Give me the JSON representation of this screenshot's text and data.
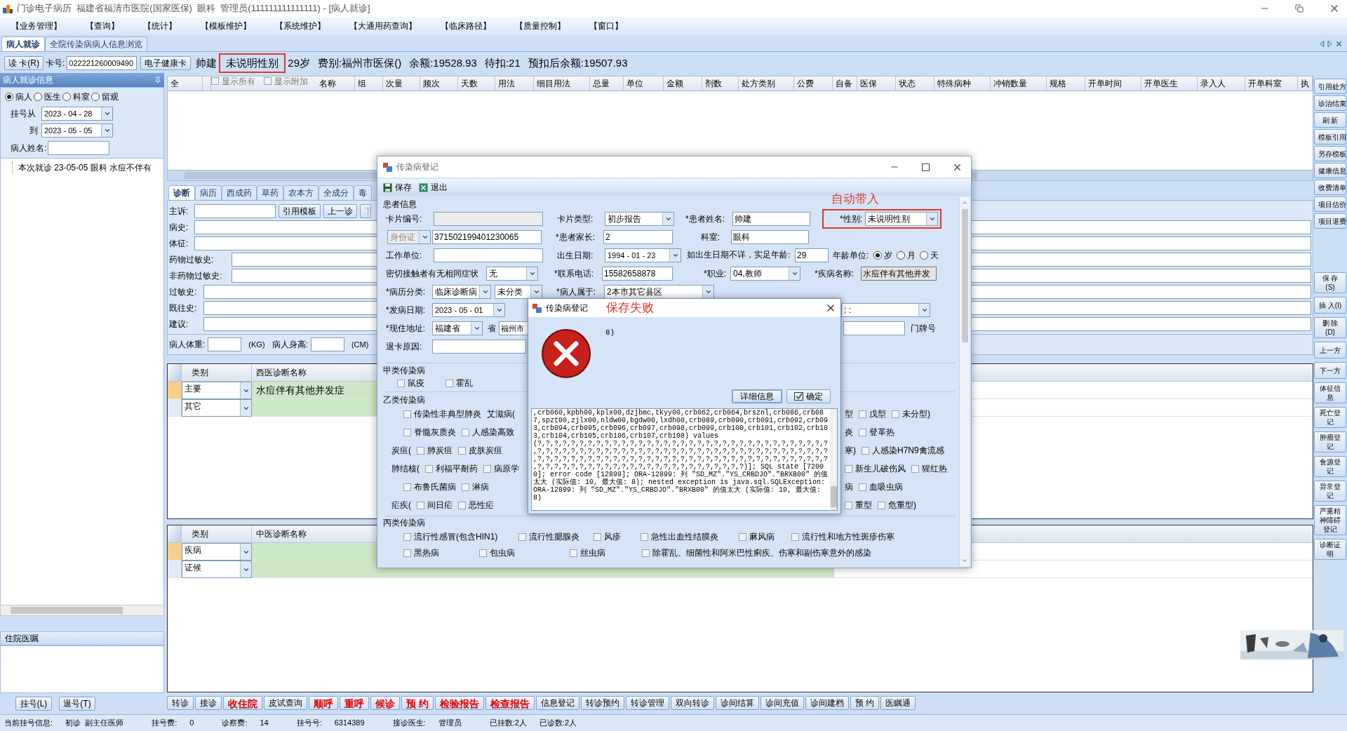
{
  "window": {
    "title": "门诊电子病历  福建省福清市医院(国家医保)  眼科  管理员(111111111111111) - [病人就诊]"
  },
  "menu": [
    "【业务管理】",
    "【查询】",
    "【统计】",
    "【模板维护】",
    "【系统维护】",
    "【大通用药查询】",
    "【临床路径】",
    "【质量控制】",
    "【窗口】"
  ],
  "tabs": [
    {
      "label": "病人就诊",
      "selected": true
    },
    {
      "label": "全院传染病病人信息浏览",
      "selected": false
    }
  ],
  "patient_bar": {
    "read_card_button": "读 卡(R)",
    "card_label": "卡号:",
    "card_number": "022221260009490",
    "health_card_button": "电子健康卡",
    "name": "帅建",
    "gender": {
      "value": "未说明性别",
      "highlighted": true
    },
    "age": "29岁",
    "fee_type": "费别:福州市医保()",
    "balance": "余额:19528.93",
    "pending": "待扣:21",
    "after_balance": "预扣后余额:19507.93"
  },
  "visit_panel": {
    "title": "病人就诊信息",
    "filters": [
      {
        "label": "病人",
        "selected": true
      },
      {
        "label": "医生",
        "selected": false
      },
      {
        "label": "科室",
        "selected": false
      },
      {
        "label": "留观",
        "selected": false
      }
    ],
    "from_label": "挂号从",
    "from_date": "2023 - 04 - 28",
    "to_label": "到",
    "to_date": "2023 - 05 - 05",
    "name_label": "病人姓名:",
    "visits": [
      "本次就诊 23-05-05 眼科 水痘不伴有"
    ]
  },
  "orders_panel": {
    "title": "住院医嘱"
  },
  "left_buttons": [
    "挂号(L)",
    "退号(T)"
  ],
  "prescription_table": {
    "columns": [
      {
        "label": "全",
        "kind": "text"
      },
      {
        "label": "显示所有",
        "kind": "checkbox",
        "checked": false
      },
      {
        "label": "显示附加",
        "kind": "checkbox",
        "checked": false
      },
      {
        "label": "名称",
        "kind": "text"
      },
      {
        "label": "组",
        "kind": "text"
      },
      {
        "label": "次量",
        "kind": "text"
      },
      {
        "label": "频次",
        "kind": "text"
      },
      {
        "label": "天数",
        "kind": "text"
      },
      {
        "label": "用法",
        "kind": "text"
      },
      {
        "label": "细目用法",
        "kind": "text"
      },
      {
        "label": "总量",
        "kind": "text"
      },
      {
        "label": "单位",
        "kind": "text"
      },
      {
        "label": "金额",
        "kind": "text"
      },
      {
        "label": "剂数",
        "kind": "text"
      },
      {
        "label": "处方类别",
        "kind": "text"
      },
      {
        "label": "公费",
        "kind": "text"
      },
      {
        "label": "自备",
        "kind": "text"
      },
      {
        "label": "医保",
        "kind": "text"
      },
      {
        "label": "状态",
        "kind": "text"
      },
      {
        "label": "特殊病种",
        "kind": "text"
      },
      {
        "label": "冲销数量",
        "kind": "text"
      },
      {
        "label": "规格",
        "kind": "text"
      },
      {
        "label": "开单时间",
        "kind": "text"
      },
      {
        "label": "开单医生",
        "kind": "text"
      },
      {
        "label": "录入人",
        "kind": "text"
      },
      {
        "label": "开单科室",
        "kind": "text"
      },
      {
        "label": "执",
        "kind": "text"
      }
    ]
  },
  "side_buttons_top": [
    "引用处方",
    "诊治结束",
    "刷 新",
    "模板引用",
    "另存模板",
    "健康信息",
    "收费清单",
    "项目估价",
    "项目退费"
  ],
  "side_buttons_bottom": [
    "保 存(S)",
    "插 入(I)",
    "删 除(D)",
    "上一方",
    "下一方",
    "体征信息",
    "死亡登记",
    "肿瘤登记",
    "食源登记",
    "异常登记",
    "严重精神障碍登记",
    "诊断证明"
  ],
  "record_tabs": [
    {
      "label": "诊断",
      "selected": true
    },
    {
      "label": "病历",
      "selected": false
    },
    {
      "label": "西成药",
      "selected": false
    },
    {
      "label": "草药",
      "selected": false
    },
    {
      "label": "农本方",
      "selected": false
    },
    {
      "label": "全成分",
      "selected": false
    },
    {
      "label": "毒",
      "selected": false
    }
  ],
  "record_buttons": [
    {
      "label": "引用模板",
      "disabled": false
    },
    {
      "label": "上一诊",
      "disabled": false
    },
    {
      "label": "下",
      "disabled": true
    }
  ],
  "record_fields": [
    "主诉:",
    "病史:",
    "体征:",
    "药物过敏史:",
    "非药物过敏史:",
    "过敏史:",
    "既往史:",
    "建议:"
  ],
  "measurements": {
    "weight_label": "病人体重:",
    "weight_unit": "(KG)",
    "height_label": "病人身高:",
    "height_unit": "(CM)"
  },
  "western_diagnosis": {
    "columns": [
      "类别",
      "西医诊断名称"
    ],
    "rows": [
      {
        "category": "主要",
        "name": "水痘伴有其他并发症",
        "selected": true
      },
      {
        "category": "其它",
        "selected": false
      }
    ]
  },
  "chinese_diagnosis": {
    "columns": [
      "类别",
      "中医诊断名称"
    ],
    "rows": [
      {
        "category": "疾病",
        "selected": true
      },
      {
        "category": "证候",
        "selected": false
      }
    ]
  },
  "action_buttons": [
    {
      "label": "转诊",
      "kind": "normal"
    },
    {
      "label": "接诊",
      "kind": "normal"
    },
    {
      "label": "收住院",
      "kind": "alert"
    },
    {
      "label": "皮试查询",
      "kind": "normal"
    },
    {
      "label": "顺呼",
      "kind": "alert"
    },
    {
      "label": "重呼",
      "kind": "alert"
    },
    {
      "label": "候诊",
      "kind": "alert"
    },
    {
      "label": "预 约",
      "kind": "alert"
    },
    {
      "label": "检验报告",
      "kind": "alert"
    },
    {
      "label": "检查报告",
      "kind": "alert"
    },
    {
      "label": "信息登记",
      "kind": "normal"
    },
    {
      "label": "转诊预约",
      "kind": "normal"
    },
    {
      "label": "转诊管理",
      "kind": "normal"
    },
    {
      "label": "双向转诊",
      "kind": "normal"
    },
    {
      "label": "诊间结算",
      "kind": "normal"
    },
    {
      "label": "诊间充值",
      "kind": "normal"
    },
    {
      "label": "诊间建档",
      "kind": "normal"
    },
    {
      "label": "预 约",
      "kind": "normal"
    },
    {
      "label": "医瞩通",
      "kind": "normal"
    }
  ],
  "status_bar": [
    {
      "label": "当前挂号信息:",
      "value": "初诊  副主任医师"
    },
    {
      "label": "挂号费:",
      "value": "0"
    },
    {
      "label": "诊察费:",
      "value": "14"
    },
    {
      "label": "挂号号:",
      "value": "6314389"
    },
    {
      "label": "接诊医生:",
      "value": "管理员"
    },
    {
      "label": "已挂数:2人",
      "value": "已诊数:2人"
    }
  ],
  "thumbnail": {
    "kind": "picture"
  },
  "report_dialog": {
    "title": "传染病登记",
    "toolbar": [
      {
        "label": "保存",
        "kind": "save"
      },
      {
        "label": "退出",
        "kind": "exit"
      }
    ],
    "annotation": "自动带入",
    "patient_group": "患者信息",
    "card_no": {
      "label": "卡片编号:",
      "disabled": true
    },
    "card_type": {
      "label": "卡片类型:",
      "value": "初步报告"
    },
    "patient_name": {
      "label": "*患者姓名:",
      "value": "帅建"
    },
    "gender": {
      "label": "*性别:",
      "value": "未说明性别",
      "highlighted": true
    },
    "id_type": {
      "value": "身份证",
      "disabled": true
    },
    "id_number": "371502199401230065",
    "guardian": {
      "label": "*患者家长:",
      "value": "2"
    },
    "department": {
      "label": "科室:",
      "value": "眼科"
    },
    "work_unit_label": "工作单位:",
    "birth_date": {
      "label": "出生日期:",
      "value": "1994 - 01 - 23"
    },
    "age": {
      "label": "如出生日期不详，实足年龄:",
      "value": "29"
    },
    "age_unit": {
      "label": "年龄单位:",
      "options": [
        {
          "label": "岁",
          "selected": true
        },
        {
          "label": "月",
          "selected": false
        },
        {
          "label": "天",
          "selected": false
        }
      ]
    },
    "contact_symptoms": {
      "label": "密切接触者有无相同症状",
      "value": "无"
    },
    "phone": {
      "label": "*联系电话:",
      "value": "15582658878"
    },
    "occupation": {
      "label": "*职业:",
      "value": "04,教师"
    },
    "disease": {
      "label": "*疾病名称:",
      "value": "水痘伴有其他并发"
    },
    "case_class": {
      "label": "*病历分类:",
      "value": "临床诊断病",
      "sub_value": "未分类"
    },
    "belongs": {
      "label": "*病人属于:",
      "value": "2本市其它县区"
    },
    "onset_date": {
      "label": "*发病日期:",
      "value": "2023 - 05 - 01"
    },
    "onset_time": ":   :",
    "address": {
      "label": "*现住地址:",
      "province": "福建省",
      "province_suffix": "省",
      "city": "福州市",
      "house_no_label": "门牌号"
    },
    "cancel_reason_label": "退卡原因:",
    "class_a": {
      "title": "甲类传染病",
      "items": [
        {
          "label": "鼠疫",
          "checked": false
        },
        {
          "label": "霍乱",
          "checked": false
        }
      ]
    },
    "class_b": {
      "title": "乙类传染病",
      "rows": [
        {
          "left": [
            {
              "kind": "checkbox",
              "label": "传染性非典型肺炎",
              "checked": false
            },
            {
              "kind": "prefix",
              "label": "艾滋病("
            }
          ],
          "right": [
            {
              "kind": "prefix",
              "label": "型"
            },
            {
              "kind": "checkbox",
              "label": "戊型",
              "checked": false
            },
            {
              "kind": "checkbox",
              "label": "未分型)",
              "checked": false
            }
          ]
        },
        {
          "left": [
            {
              "kind": "checkbox",
              "label": "脊髓灰质炎",
              "checked": false
            },
            {
              "kind": "checkbox",
              "label": "人感染高致",
              "checked": false
            }
          ],
          "right": [
            {
              "kind": "prefix",
              "label": "炎"
            },
            {
              "kind": "checkbox",
              "label": "登革热",
              "checked": false
            }
          ]
        },
        {
          "left": [
            {
              "kind": "prefix",
              "label": "炭疽("
            },
            {
              "kind": "checkbox",
              "label": "肺炭疽",
              "checked": false
            },
            {
              "kind": "checkbox",
              "label": "皮肤炭疽",
              "checked": false
            }
          ],
          "right": [
            {
              "kind": "prefix",
              "label": "寒)"
            },
            {
              "kind": "checkbox",
              "label": "人感染H7N9禽流感",
              "checked": false
            }
          ]
        },
        {
          "left": [
            {
              "kind": "prefix",
              "label": "肺结核("
            },
            {
              "kind": "checkbox",
              "label": "利福平耐药",
              "checked": false
            },
            {
              "kind": "checkbox",
              "label": "病原学",
              "checked": false
            }
          ],
          "right": [
            {
              "kind": "checkbox",
              "label": "新生儿破伤风",
              "checked": false
            },
            {
              "kind": "checkbox",
              "label": "猩红热",
              "checked": false
            }
          ]
        },
        {
          "left": [
            {
              "kind": "checkbox",
              "label": "布鲁氏菌病",
              "checked": false
            },
            {
              "kind": "checkbox",
              "label": "淋病",
              "checked": false
            }
          ],
          "right": [
            {
              "kind": "prefix",
              "label": "病"
            },
            {
              "kind": "checkbox",
              "label": "血吸虫病",
              "checked": false
            }
          ]
        },
        {
          "left": [
            {
              "kind": "prefix",
              "label": "疟疾("
            },
            {
              "kind": "checkbox",
              "label": "间日疟",
              "checked": false
            },
            {
              "kind": "checkbox",
              "label": "恶性疟",
              "checked": false
            }
          ],
          "right": [
            {
              "kind": "checkbox",
              "label": "重型",
              "checked": false
            },
            {
              "kind": "checkbox",
              "label": "危重型)",
              "checked": false
            }
          ]
        }
      ]
    },
    "class_c": {
      "title": "丙类传染病",
      "rows": [
        {
          "items": [
            {
              "label": "流行性感冒(包含HIN1)",
              "checked": false
            },
            {
              "label": "流行性腮腺炎",
              "checked": false
            },
            {
              "label": "风疹",
              "checked": false
            },
            {
              "label": "急性出血性结膜炎",
              "checked": false
            },
            {
              "label": "麻风病",
              "checked": false
            },
            {
              "label": "流行性和地方性斑疹伤寒",
              "checked": false
            }
          ]
        },
        {
          "items": [
            {
              "label": "黑热病",
              "checked": false
            },
            {
              "label": "包虫病",
              "checked": false
            },
            {
              "label": "丝虫病",
              "checked": false
            },
            {
              "label": "除霍乱、细菌性和阿米巴性痢疾、伤寒和副伤寒意外的感染",
              "checked": false
            }
          ]
        }
      ]
    }
  },
  "error_dialog": {
    "title": "传染病登记",
    "annotation": "保存失败",
    "message": "8)",
    "buttons": [
      {
        "label": "详细信息",
        "kind": "details"
      },
      {
        "label": "确定",
        "kind": "ok"
      }
    ],
    "details": ",crb060,kpbh00,kplx00,dzjbmc,tkyy00,crb062,crb064,brsznl,crb086,crb087,spzt00,zjlx00,nldw00,bgdw00,lxdh00,crb089,crb090,crb091,crb092,crb093,crb094,crb095,crb096,crb097,crb098,crb099,crb100,crb101,crb102,crb103,crb104,crb105,crb106,crb107,crb108) values (?,?,?,?,?,?,?,?,?,?,?,?,?,?,?,?,?,?,?,?,?,?,?,?,?,?,?,?,?,?,?,?,?,?,?,?,?,?,?,?,?,?,?,?,?,?,?,?,?,?,?,?,?,?,?,?,?,?,?,?,?,?,?,?,?,?,?,?,?,?,?,?,?,?,?,?,?,?,?,?,?,?,?,?,?,?,?,?,?,?,?,?,?,?,?,?,?,?,?,?,?,?,?,?,?,?,?,?,?,?,?,?,?,?,?,?,?,?,?,?,?,?,?,?,?,?,?,?,?,?)]; SQL state [72000]; error code [12899]; ORA-12899: 列 \"SD_MZ\".\"YS_CRBDJO\".\"BRXB00\" 的值太大 (实际值: 10, 最大值: 8); nested exception is java.sql.SQLException: ORA-12899: 列 \"SD_MZ\".\"YS_CRBDJO\".\"BRXB00\" 的值太大 (实际值: 10, 最大值: 8)"
  }
}
